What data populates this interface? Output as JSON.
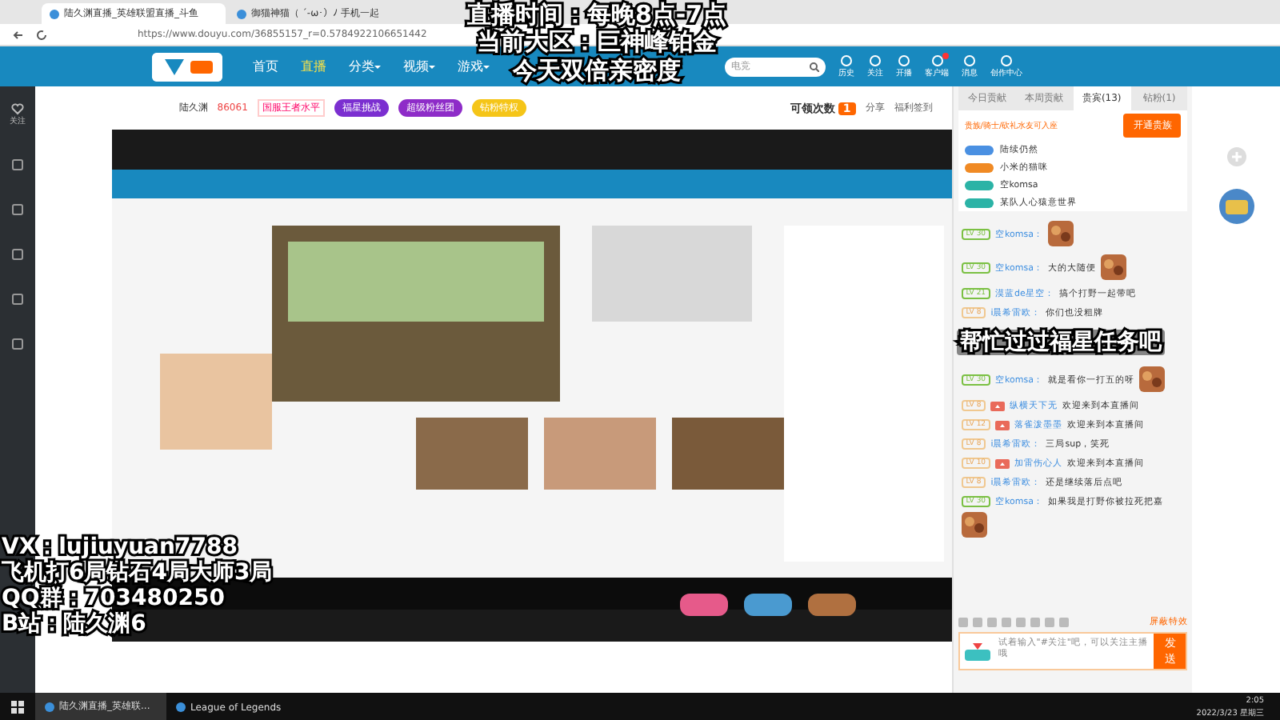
{
  "browser": {
    "tabs": [
      {
        "title": "陆久渊直播_英雄联盟直播_斗鱼",
        "selected": true
      },
      {
        "title": "御猫神猫（ ´-ω･）ﾉ 手机一起",
        "selected": false
      }
    ],
    "url": "https://www.douyu.com/36855157_r=0.5784922106651442"
  },
  "site": {
    "nav": [
      {
        "label": "首页",
        "selected": false,
        "dropdown": false
      },
      {
        "label": "直播",
        "selected": true,
        "dropdown": false
      },
      {
        "label": "分类",
        "selected": false,
        "dropdown": true
      },
      {
        "label": "视频",
        "selected": false,
        "dropdown": true
      },
      {
        "label": "游戏",
        "selected": false,
        "dropdown": true
      }
    ],
    "search": {
      "placeholder": "电竞"
    },
    "icons": [
      {
        "label": "历史",
        "badge": false
      },
      {
        "label": "关注",
        "badge": false
      },
      {
        "label": "开播",
        "badge": false
      },
      {
        "label": "客户端",
        "badge": true
      },
      {
        "label": "消息",
        "badge": false
      },
      {
        "label": "创作中心",
        "badge": false
      }
    ]
  },
  "sidebar": {
    "items": [
      {
        "label": "关注"
      }
    ]
  },
  "room": {
    "streamer": "陆久渊",
    "heat": "86061",
    "tag": "国服王者水平",
    "pills": [
      {
        "label": "福星挑战",
        "color": "#7b2fd0"
      },
      {
        "label": "超级粉丝团",
        "color": "#8e2cc8"
      },
      {
        "label": "钻粉特权",
        "color": "#f5c518"
      }
    ],
    "claim": {
      "label": "可领次数",
      "count": "1"
    },
    "actions": [
      "分享",
      "福利签到"
    ],
    "video": {
      "kind": "picture"
    }
  },
  "chat": {
    "tabs": [
      {
        "label": "今日贡献",
        "selected": false
      },
      {
        "label": "本周贡献",
        "selected": false
      },
      {
        "label": "贵宾(13)",
        "selected": true
      },
      {
        "label": "钻粉(1)",
        "selected": false
      }
    ],
    "noble_note": "贵族/骑士/砍礼水友可入座",
    "noble_button": "开通贵族",
    "viewers": [
      {
        "name": "陆续仍然",
        "color": "#4a90e2"
      },
      {
        "name": "小米的猫咪",
        "color": "#f08a24"
      },
      {
        "name": "空komsa",
        "color": "#2bb3a6"
      },
      {
        "name": "某队人心猿意世界",
        "color": "#2bb3a6"
      }
    ],
    "messages": [
      {
        "kind": "sticker",
        "level": "LV 30",
        "user": "空komsa："
      },
      {
        "kind": "chat",
        "level": "LV 30",
        "user": "空komsa：",
        "text": "大的大随便",
        "sticker": true
      },
      {
        "kind": "chat",
        "level": "LV 21",
        "user": "漠蓝de星空：",
        "text": "搞个打野一起带吧",
        "sticker": false
      },
      {
        "kind": "chat",
        "level": "LV 8",
        "user": "i晨希雷欧：",
        "text": "你们也没粗牌",
        "sticker": false
      },
      {
        "kind": "chat",
        "level": "LV 30",
        "user": "空komsa：",
        "text": "就是看你一打五的呀",
        "sticker": true
      },
      {
        "kind": "enter",
        "level": "LV 8",
        "user": "纵横天下无",
        "text": "欢迎来到本直播间"
      },
      {
        "kind": "enter",
        "level": "LV 12",
        "user": "落雀泼墨墨",
        "text": "欢迎来到本直播间"
      },
      {
        "kind": "chat",
        "level": "LV 8",
        "user": "i晨希雷欧：",
        "text": "三局sup，笑死",
        "sticker": false
      },
      {
        "kind": "enter",
        "level": "LV 10",
        "user": "加雷伤心人",
        "text": "欢迎来到本直播间"
      },
      {
        "kind": "chat",
        "level": "LV 8",
        "user": "i晨希雷欧：",
        "text": "还是继续落后点吧",
        "sticker": false
      },
      {
        "kind": "chat",
        "level": "LV 30",
        "user": "空komsa：",
        "text": "如果我是打野你被拉死把嘉",
        "sticker": true
      }
    ],
    "shield": "屏蔽特效",
    "input_placeholder": "试着输入\"#关注\"吧，可以关注主播哦",
    "send": "发送"
  },
  "taskbar": {
    "apps": [
      {
        "label": "陆久渊直播_英雄联...",
        "selected": true
      },
      {
        "label": "League of Legends",
        "selected": false
      }
    ],
    "time": "2:05",
    "date": "2022/3/23 星期三"
  },
  "overlays": {
    "top": [
      "直播时间：每晚8点-7点",
      "当前大区：巨神峰铂金",
      "今天双倍亲密度"
    ],
    "bottom_left": [
      "VX：lujiuyuan7788",
      "飞机打6局钻石4局大师3局",
      "QQ群：703480250",
      "B站：陆久渊6"
    ],
    "right": "帮忙过过福星任务吧"
  }
}
